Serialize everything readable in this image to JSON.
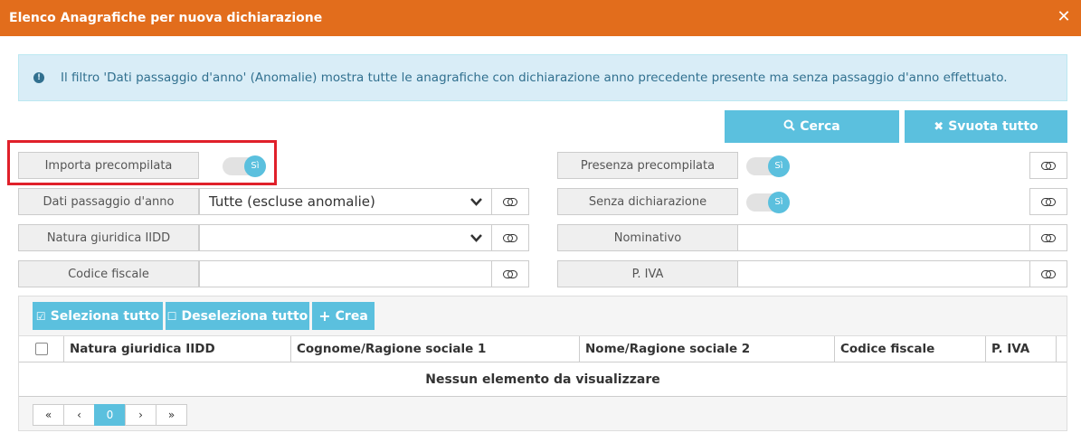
{
  "dialog": {
    "title": "Elenco Anagrafiche per nuova dichiarazione",
    "close_glyph": "✕"
  },
  "alert": {
    "icon": "info-icon",
    "text": "Il filtro 'Dati passaggio d'anno' (Anomalie) mostra tutte le anagrafiche con dichiarazione anno precedente presente ma senza passaggio d'anno effettuato."
  },
  "actions": {
    "search_label": "Cerca",
    "clear_label": "Svuota tutto"
  },
  "filters": {
    "importa_precompilata": {
      "label": "Importa precompilata",
      "toggle": "Sì"
    },
    "presenza_precompilata": {
      "label": "Presenza precompilata",
      "toggle": "Sì"
    },
    "dati_passaggio": {
      "label": "Dati passaggio d'anno",
      "value": "Tutte (escluse anomalie)"
    },
    "senza_dichiarazione": {
      "label": "Senza dichiarazione",
      "toggle": "Sì"
    },
    "natura_giuridica": {
      "label": "Natura giuridica IIDD",
      "value": ""
    },
    "nominativo": {
      "label": "Nominativo",
      "value": ""
    },
    "codice_fiscale": {
      "label": "Codice fiscale",
      "value": ""
    },
    "piva": {
      "label": "P. IVA",
      "value": ""
    }
  },
  "toolbar": {
    "select_all": "Seleziona tutto",
    "deselect_all": "Deseleziona tutto",
    "create": "Crea"
  },
  "table": {
    "columns": [
      "Natura giuridica IIDD",
      "Cognome/Ragione sociale 1",
      "Nome/Ragione sociale 2",
      "Codice fiscale",
      "P. IVA"
    ],
    "empty_message": "Nessun elemento da visualizzare"
  },
  "pager": {
    "first": "«",
    "prev": "‹",
    "current": "0",
    "next": "›",
    "last": "»"
  },
  "colors": {
    "titlebar": "#e26d1c",
    "accent": "#5bc0de",
    "alert_bg": "#d9edf7",
    "highlight": "#e0202a"
  }
}
